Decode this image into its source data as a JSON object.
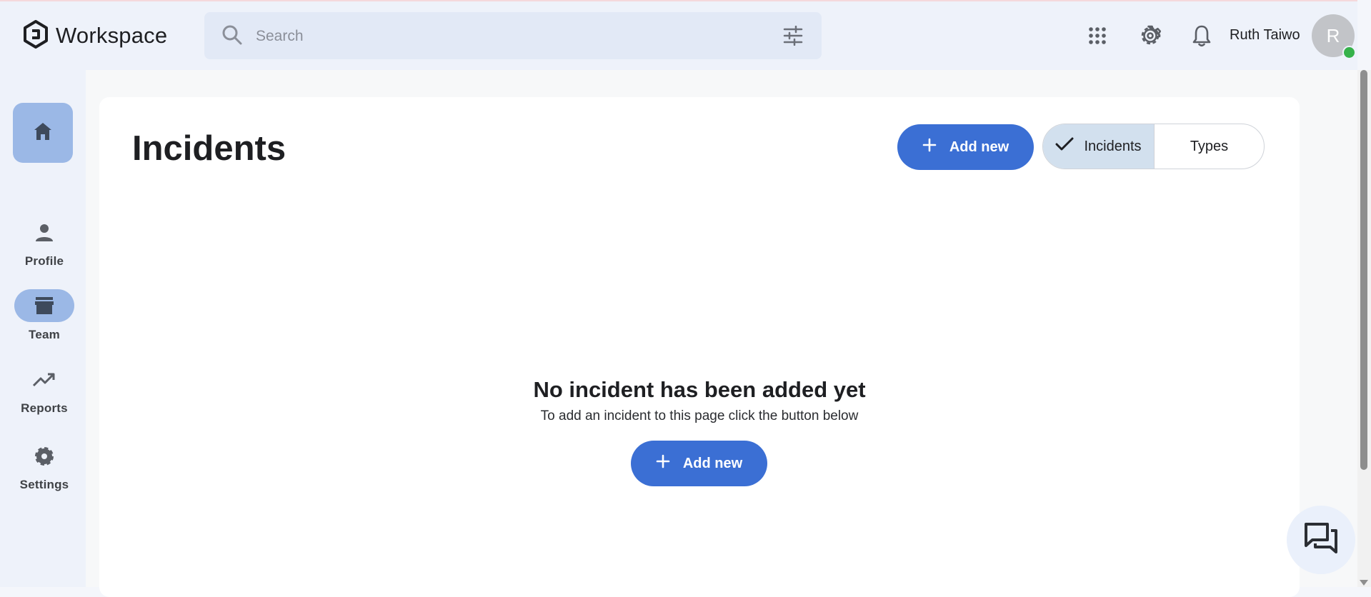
{
  "app": {
    "title": "Workspace"
  },
  "search": {
    "placeholder": "Search"
  },
  "user": {
    "name": "Ruth Taiwo",
    "initial": "R"
  },
  "sidebar": {
    "items": [
      {
        "label": "Profile"
      },
      {
        "label": "Team"
      },
      {
        "label": "Reports"
      },
      {
        "label": "Settings"
      }
    ]
  },
  "page": {
    "title": "Incidents",
    "add_label": "Add new",
    "toggle": {
      "active": "Incidents",
      "other": "Types"
    }
  },
  "empty": {
    "title": "No incident has been added yet",
    "subtitle": "To add an incident to this page click the button below",
    "add_label": "Add new"
  },
  "colors": {
    "primary": "#3b6fd4",
    "nav_active": "#9bb8e6",
    "toggle_active": "#d2e0ee",
    "online": "#36b24a"
  }
}
